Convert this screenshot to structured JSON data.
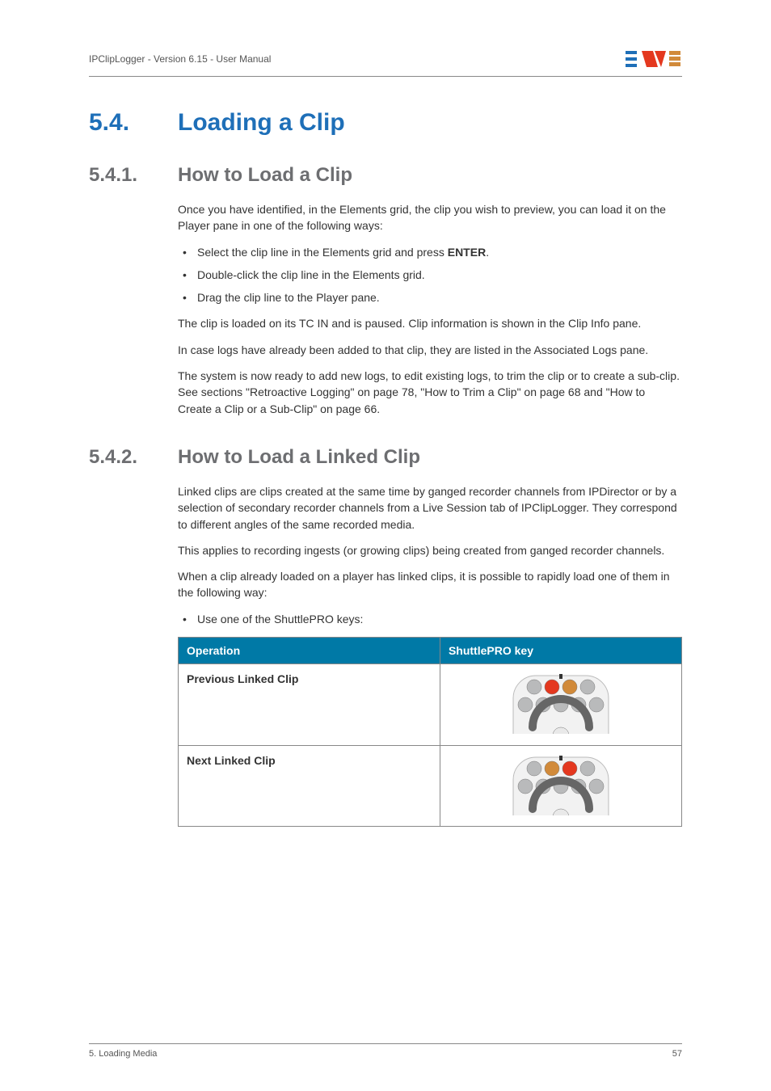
{
  "header": {
    "doc_title": "IPClipLogger - Version 6.15 - User Manual",
    "logo_alt": "EVS"
  },
  "h1": {
    "num": "5.4.",
    "title": "Loading a Clip"
  },
  "s541": {
    "num": "5.4.1.",
    "title": "How to Load a Clip",
    "intro": "Once you have identified, in the Elements grid, the clip you wish to preview, you can load it on the Player pane in one of the following ways:",
    "bullets": {
      "b1_pre": "Select the clip line in the Elements grid and press ",
      "b1_key": "ENTER",
      "b1_post": ".",
      "b2": "Double-click the clip line in the Elements grid.",
      "b3": "Drag the clip line to the Player pane."
    },
    "p_after1": "The clip is loaded on its TC IN and is paused. Clip information is shown in the Clip Info pane.",
    "p_after2": "In case logs have already been added to that clip, they are listed in the Associated Logs pane.",
    "p_after3": "The system is now ready to add new logs, to edit existing logs, to trim the clip or to create a sub-clip. See sections \"Retroactive Logging\" on page 78, \"How to Trim a Clip\" on page 68 and \"How to Create a Clip or a Sub-Clip\" on page 66."
  },
  "s542": {
    "num": "5.4.2.",
    "title": "How to Load a Linked Clip",
    "p1": "Linked clips are clips created at the same time by ganged recorder channels from IPDirector or by a selection of secondary recorder channels from a Live Session tab of IPClipLogger. They correspond to different angles of the same recorded media.",
    "p2": "This applies to recording ingests (or growing clips) being created from ganged recorder channels.",
    "p3": "When a clip already loaded on a player has linked clips, it is possible to rapidly load one of them in the following way:",
    "bullet": "Use one of the ShuttlePRO keys:",
    "table": {
      "col1": "Operation",
      "col2": "ShuttlePRO key",
      "rows": [
        {
          "op": "Previous Linked Clip",
          "highlight": 2
        },
        {
          "op": "Next Linked Clip",
          "highlight": 3
        }
      ]
    }
  },
  "footer": {
    "left": "5. Loading Media",
    "right": "57"
  },
  "colors": {
    "teal": "#0079a6",
    "row_even_btn": "#d18a3a",
    "row_even_hl": "#e4381f",
    "btn_grey": "#b9babb"
  }
}
